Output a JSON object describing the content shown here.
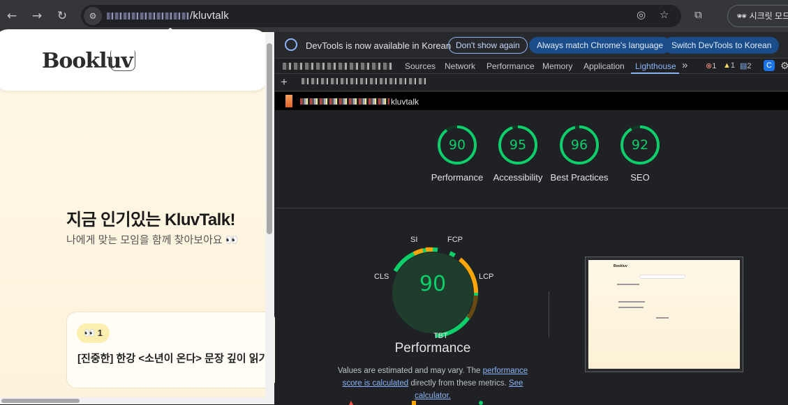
{
  "browser": {
    "url_suffix": "/kluvtalk",
    "incognito_label": "시크릿 모드"
  },
  "page": {
    "logo": "Bookluv",
    "title": "지금 인기있는 KluvTalk!",
    "subtitle": "나에게 맞는 모임을 함께 찾아보아요 👀",
    "card_rank": "👀 1",
    "card_title": "[진중한] 한강 <소년이 온다> 문장 깊이 읽기"
  },
  "devtools": {
    "infobar": {
      "message": "DevTools is now available in Korean",
      "dont_show": "Don't show again",
      "always_match": "Always match Chrome's language",
      "switch": "Switch DevTools to Korean"
    },
    "tabs": [
      "Sources",
      "Network",
      "Performance",
      "Memory",
      "Application",
      "Lighthouse"
    ],
    "more_tabs": "»",
    "errors": "1",
    "warnings": "1",
    "messages": "2",
    "report_url_suffix": "kluvtalk",
    "categories": [
      {
        "label": "Performance",
        "score": "90"
      },
      {
        "label": "Accessibility",
        "score": "95"
      },
      {
        "label": "Best Practices",
        "score": "96"
      },
      {
        "label": "SEO",
        "score": "92"
      }
    ],
    "performance": {
      "score": "90",
      "title": "Performance",
      "metrics": [
        "SI",
        "FCP",
        "LCP",
        "TBT",
        "CLS"
      ],
      "note_pre": "Values are estimated and may vary. The ",
      "note_link1": "performance score is calculated",
      "note_mid": " directly from these metrics. ",
      "note_link2": "See calculator."
    },
    "colors": {
      "pass": "#0cce6b",
      "average": "#ffa400",
      "fail": "#ff4e42",
      "accent": "#8ab4f8"
    }
  }
}
